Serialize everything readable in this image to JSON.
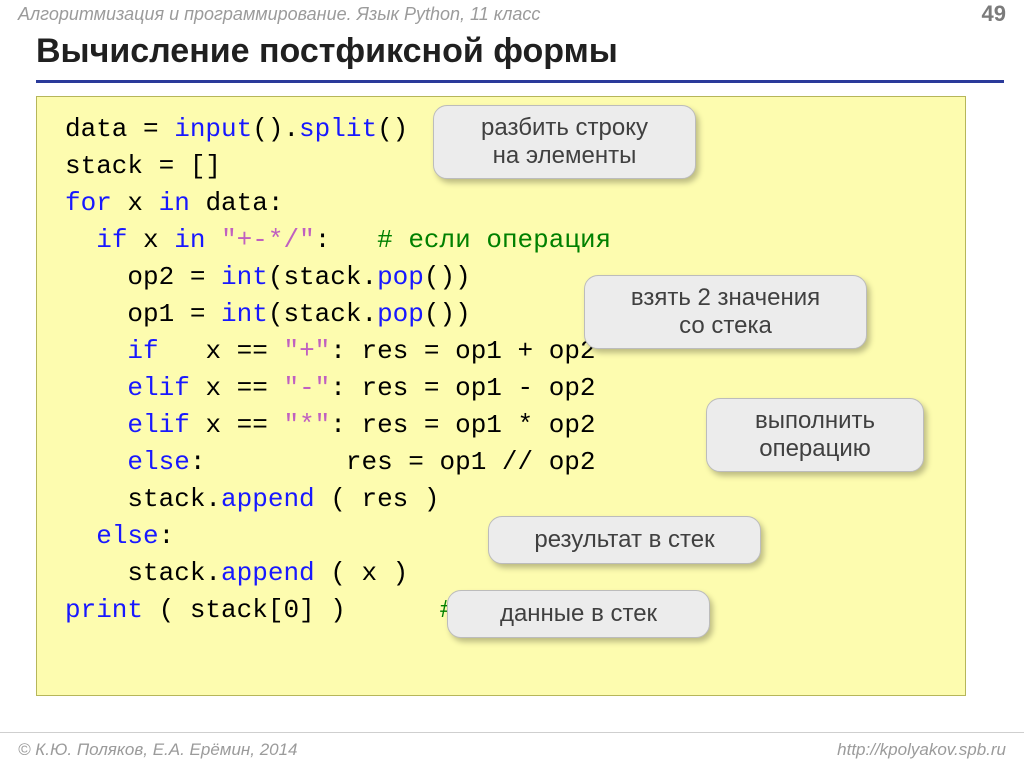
{
  "header": {
    "course": "Алгоритмизация и программирование. Язык Python, 11 класс",
    "page": "49"
  },
  "title": "Вычисление постфиксной формы",
  "code": {
    "l1_a": "data = ",
    "l1_b": "input",
    "l1_c": "().",
    "l1_d": "split",
    "l1_e": "()",
    "l2": "stack = []",
    "l3_a": "for",
    "l3_b": " x ",
    "l3_c": "in",
    "l3_d": " data:",
    "l4_a": "  ",
    "l4_b": "if",
    "l4_c": " x ",
    "l4_d": "in",
    "l4_e": " ",
    "l4_f": "\"+-*/\"",
    "l4_g": ":   ",
    "l4_h": "# если операция",
    "l5_a": "    op2 = ",
    "l5_b": "int",
    "l5_c": "(stack.",
    "l5_d": "pop",
    "l5_e": "())",
    "l6_a": "    op1 = ",
    "l6_b": "int",
    "l6_c": "(stack.",
    "l6_d": "pop",
    "l6_e": "())",
    "l7_a": "    ",
    "l7_b": "if",
    "l7_c": "   x == ",
    "l7_d": "\"+\"",
    "l7_e": ": res = op1 + op2",
    "l8_a": "    ",
    "l8_b": "elif",
    "l8_c": " x == ",
    "l8_d": "\"-\"",
    "l8_e": ": res = op1 - op2",
    "l9_a": "    ",
    "l9_b": "elif",
    "l9_c": " x == ",
    "l9_d": "\"*\"",
    "l9_e": ": res = op1 * op2",
    "l10_a": "    ",
    "l10_b": "else",
    "l10_c": ":         res = op1 // op2",
    "l11_a": "    stack.",
    "l11_b": "append",
    "l11_c": " ( res )",
    "l12_a": "  ",
    "l12_b": "else",
    "l12_c": ":",
    "l13_a": "    stack.",
    "l13_b": "append",
    "l13_c": " ( x )",
    "l14_a": "print",
    "l14_b": " ( stack[0] )      ",
    "l14_c": "# результат"
  },
  "callouts": {
    "c1": "разбить строку\nна элементы",
    "c2": "взять 2 значения\nсо стека",
    "c3": "выполнить\nоперацию",
    "c4": "результат в стек",
    "c5": "данные в стек"
  },
  "footer": {
    "copyright": "© К.Ю. Поляков, Е.А. Ерёмин, 2014",
    "url": "http://kpolyakov.spb.ru"
  }
}
